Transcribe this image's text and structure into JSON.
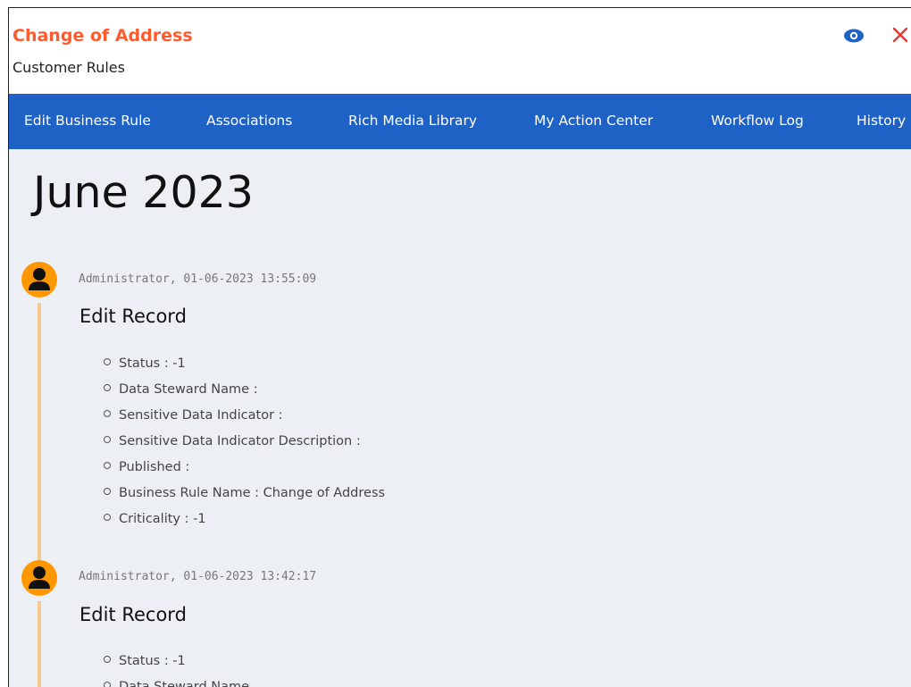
{
  "header": {
    "title": "Change of Address",
    "subtitle": "Customer Rules",
    "icons": {
      "view": "eye-icon",
      "close": "close-icon"
    },
    "colors": {
      "title": "#ff5a2b",
      "action": "#1f62c6",
      "close": "#e53935"
    }
  },
  "tabs": [
    {
      "label": "Edit Business Rule"
    },
    {
      "label": "Associations"
    },
    {
      "label": "Rich Media Library"
    },
    {
      "label": "My Action Center"
    },
    {
      "label": "Workflow Log"
    },
    {
      "label": "History"
    }
  ],
  "timeline": {
    "month_heading": "June 2023",
    "entries": [
      {
        "meta": "Administrator, 01-06-2023 13:55:09",
        "title": "Edit Record",
        "details": [
          "Status : -1",
          "Data Steward Name :",
          "Sensitive Data Indicator :",
          "Sensitive Data Indicator Description :",
          "Published :",
          "Business Rule Name : Change of Address",
          "Criticality : -1"
        ]
      },
      {
        "meta": "Administrator, 01-06-2023 13:42:17",
        "title": "Edit Record",
        "details": [
          "Status : -1",
          "Data Steward Name"
        ]
      }
    ]
  }
}
